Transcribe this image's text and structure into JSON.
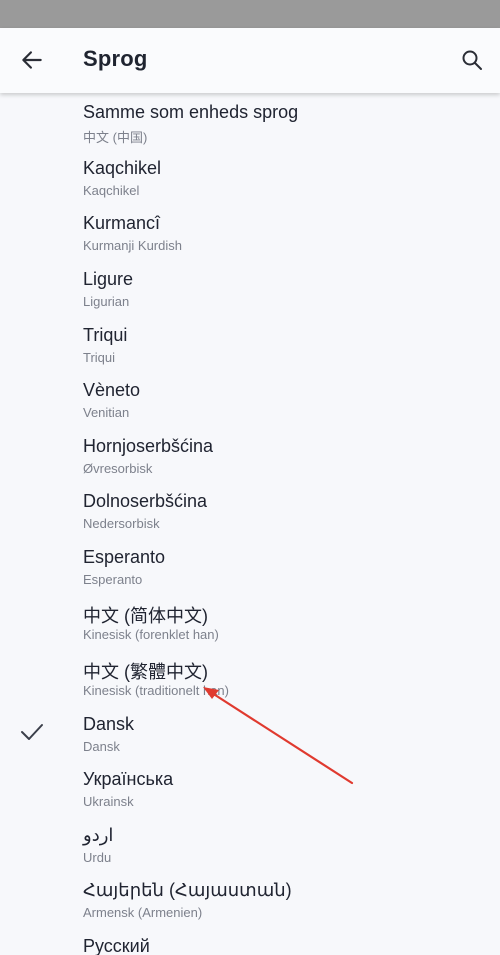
{
  "app_bar": {
    "title": "Sprog",
    "back_icon": "arrow-left-icon",
    "search_icon": "search-icon"
  },
  "languages": [
    {
      "name": "Samme som enheds sprog",
      "subtitle": "中文 (中国)",
      "selected": false
    },
    {
      "name": "Kaqchikel",
      "subtitle": "Kaqchikel",
      "selected": false
    },
    {
      "name": "Kurmancî",
      "subtitle": "Kurmanji Kurdish",
      "selected": false
    },
    {
      "name": "Ligure",
      "subtitle": "Ligurian",
      "selected": false
    },
    {
      "name": "Triqui",
      "subtitle": "Triqui",
      "selected": false
    },
    {
      "name": "Vèneto",
      "subtitle": "Venitian",
      "selected": false
    },
    {
      "name": "Hornjoserbšćina",
      "subtitle": "Øvresorbisk",
      "selected": false
    },
    {
      "name": "Dolnoserbšćina",
      "subtitle": "Nedersorbisk",
      "selected": false
    },
    {
      "name": "Esperanto",
      "subtitle": "Esperanto",
      "selected": false
    },
    {
      "name": "中文 (简体中文)",
      "subtitle": "Kinesisk (forenklet han)",
      "selected": false
    },
    {
      "name": "中文 (繁體中文)",
      "subtitle": "Kinesisk (traditionelt han)",
      "selected": false
    },
    {
      "name": "Dansk",
      "subtitle": "Dansk",
      "selected": true
    },
    {
      "name": "Українська",
      "subtitle": "Ukrainsk",
      "selected": false
    },
    {
      "name": "اردو",
      "subtitle": "Urdu",
      "selected": false
    },
    {
      "name": "Հայերեն (Հայաստան)",
      "subtitle": "Armensk (Armenien)",
      "selected": false
    },
    {
      "name": "Русский",
      "subtitle": "",
      "selected": false
    }
  ],
  "colors": {
    "annotation_arrow": "#e03a2f",
    "check": "#3b3f4a"
  }
}
